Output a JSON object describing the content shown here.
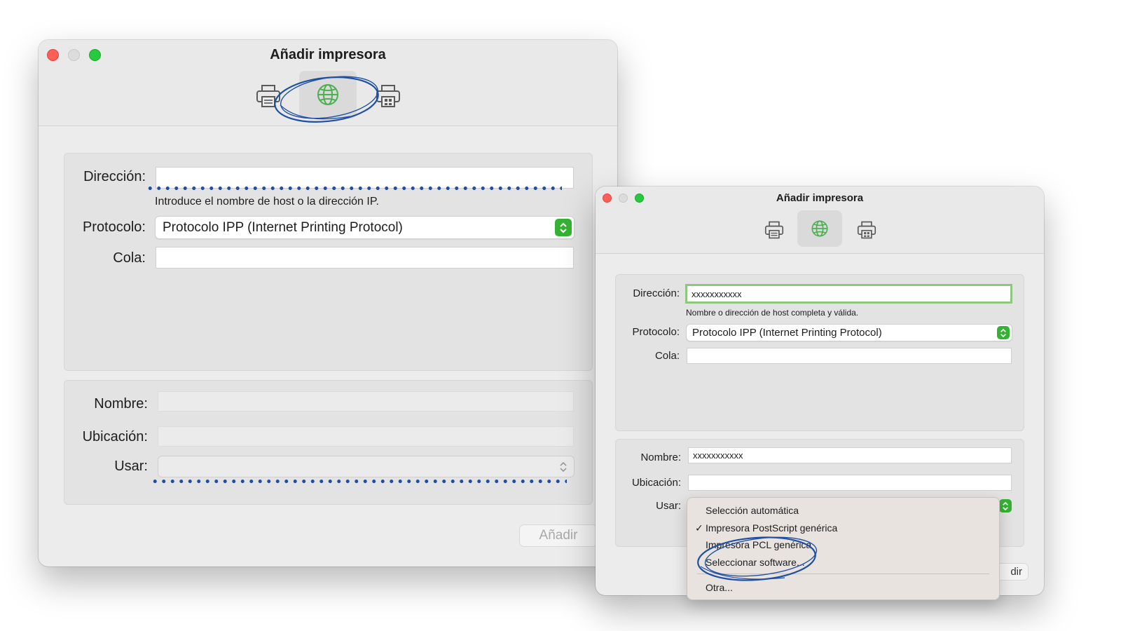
{
  "left_window": {
    "title": "Añadir impresora",
    "toolbar": [
      {
        "icon": "printer-icon",
        "selected": false
      },
      {
        "icon": "globe-icon",
        "selected": true
      },
      {
        "icon": "windows-printer-icon",
        "selected": false
      }
    ],
    "direccion_label": "Dirección:",
    "direccion_value": "",
    "direccion_hint": "Introduce el nombre de host o la dirección IP.",
    "protocolo_label": "Protocolo:",
    "protocolo_value": "Protocolo IPP (Internet Printing Protocol)",
    "cola_label": "Cola:",
    "cola_value": "",
    "nombre_label": "Nombre:",
    "ubicacion_label": "Ubicación:",
    "usar_label": "Usar:",
    "usar_value": "",
    "add_button": "Añadir"
  },
  "right_window": {
    "title": "Añadir impresora",
    "toolbar": [
      {
        "icon": "printer-icon",
        "selected": false
      },
      {
        "icon": "globe-icon",
        "selected": true
      },
      {
        "icon": "windows-printer-icon",
        "selected": false
      }
    ],
    "direccion_label": "Dirección:",
    "direccion_value": "xxxxxxxxxxx",
    "direccion_hint": "Nombre o dirección de host completa y válida.",
    "protocolo_label": "Protocolo:",
    "protocolo_value": "Protocolo IPP (Internet Printing Protocol)",
    "cola_label": "Cola:",
    "cola_value": "",
    "nombre_label": "Nombre:",
    "nombre_value": "xxxxxxxxxxx",
    "ubicacion_label": "Ubicación:",
    "ubicacion_value": "",
    "usar_label": "Usar:",
    "add_button_partial": "dir",
    "usar_menu": {
      "items": [
        {
          "label": "Selección automática",
          "checked": false
        },
        {
          "label": "Impresora PostScript genérica",
          "checked": true
        },
        {
          "label": "Impresora PCL genérica",
          "checked": false
        },
        {
          "label": "Seleccionar software...",
          "checked": false
        }
      ],
      "other": "Otra...",
      "check_mark": "✓"
    }
  },
  "colors": {
    "annotation": "#1f4fa3",
    "accent_green": "#34b233",
    "valid_border": "#8fc77e",
    "globe_green": "#4caf50"
  }
}
